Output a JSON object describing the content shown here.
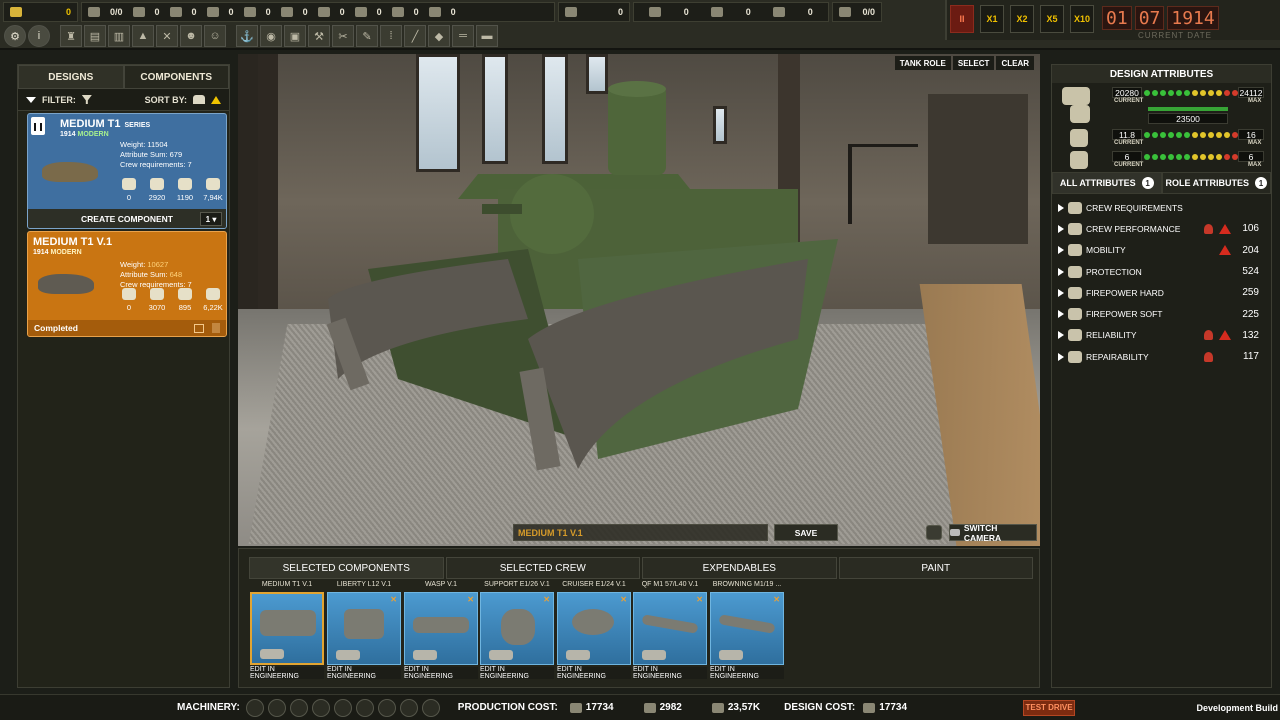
{
  "resources": {
    "money": "0",
    "items": [
      {
        "icon": "rubber-icon",
        "value": "0/0"
      },
      {
        "icon": "steel-icon",
        "value": "0"
      },
      {
        "icon": "fuel-icon",
        "value": "0"
      },
      {
        "icon": "coal-icon",
        "value": "0"
      },
      {
        "icon": "aluminium-icon",
        "value": "0"
      },
      {
        "icon": "wood-icon",
        "value": "0"
      },
      {
        "icon": "oil-icon",
        "value": "0"
      },
      {
        "icon": "chemicals-icon",
        "value": "0"
      },
      {
        "icon": "iron-icon",
        "value": "0"
      },
      {
        "icon": "tools-icon",
        "value": "0"
      }
    ],
    "factory": "0",
    "workers": [
      "0",
      "0",
      "0"
    ],
    "housing": "0/0"
  },
  "speed": {
    "pause": "II",
    "x1": "X1",
    "x2": "X2",
    "x5": "X5",
    "x10": "X10"
  },
  "date": {
    "day": "01",
    "month": "07",
    "year": "1914",
    "label": "CURRENT DATE"
  },
  "left": {
    "tabs": [
      "DESIGNS",
      "COMPONENTS"
    ],
    "filter_label": "FILTER:",
    "sortby_label": "SORT BY:",
    "cards": [
      {
        "title": "MEDIUM T1",
        "tag": "SERIES",
        "year": "1914",
        "era": "MODERN",
        "weight": "Weight: 11504",
        "attr": "Attribute Sum: 679",
        "crew": "Crew requirements: 7",
        "stats": [
          "0",
          "2920",
          "1190",
          "7,94K"
        ],
        "action": "CREATE COMPONENT",
        "qty": "1"
      },
      {
        "title": "MEDIUM T1 V.1",
        "year": "1914",
        "era": "MODERN",
        "weight_label": "Weight:",
        "weight_value": "10627",
        "attr_label": "Attribute Sum:",
        "attr_value": "648",
        "crew": "Crew requirements: 7",
        "stats": [
          "0",
          "3070",
          "895",
          "6,22K"
        ],
        "status": "Completed"
      }
    ]
  },
  "scene": {
    "tank_role": "TANK ROLE",
    "select": "SELECT",
    "clear": "CLEAR",
    "design_name": "MEDIUM T1 V.1",
    "save": "SAVE",
    "switch_camera": "SWITCH CAMERA"
  },
  "right": {
    "title": "DESIGN ATTRIBUTES",
    "rows": [
      {
        "current": "20280",
        "max": "24112"
      },
      {
        "mid": "23500"
      },
      {
        "current": "11.8",
        "max": "16"
      },
      {
        "current": "6",
        "max": "6"
      }
    ],
    "current_label": "CURRENT",
    "max_label": "MAX",
    "tabs": [
      {
        "label": "ALL ATTRIBUTES",
        "badge": "1"
      },
      {
        "label": "ROLE ATTRIBUTES",
        "badge": "1"
      }
    ],
    "attributes": [
      {
        "name": "CREW REQUIREMENTS",
        "value": ""
      },
      {
        "name": "CREW PERFORMANCE",
        "value": "106"
      },
      {
        "name": "MOBILITY",
        "value": "204"
      },
      {
        "name": "PROTECTION",
        "value": "524"
      },
      {
        "name": "FIREPOWER HARD",
        "value": "259"
      },
      {
        "name": "FIREPOWER SOFT",
        "value": "225"
      },
      {
        "name": "RELIABILITY",
        "value": "132"
      },
      {
        "name": "REPAIRABILITY",
        "value": "117"
      }
    ]
  },
  "bottom": {
    "tabs": [
      "SELECTED COMPONENTS",
      "SELECTED CREW",
      "EXPENDABLES",
      "PAINT"
    ],
    "components": [
      {
        "name": "MEDIUM T1 V.1",
        "action": "EDIT IN ENGINEERING"
      },
      {
        "name": "LIBERTY L12 V.1",
        "action": "EDIT IN ENGINEERING"
      },
      {
        "name": "WASP V.1",
        "action": "EDIT IN ENGINEERING"
      },
      {
        "name": "SUPPORT E1/26 V.1",
        "action": "EDIT IN ENGINEERING"
      },
      {
        "name": "CRUISER E1/24 V.1",
        "action": "EDIT IN ENGINEERING"
      },
      {
        "name": "QF M1 57/L40 V.1",
        "action": "EDIT IN ENGINEERING"
      },
      {
        "name": "BROWNING M1/19 ...",
        "action": "EDIT IN ENGINEERING"
      }
    ]
  },
  "footer": {
    "machinery": "MACHINERY:",
    "production_cost": "PRODUCTION COST:",
    "prod_values": [
      "17734",
      "2982",
      "23,57K"
    ],
    "design_cost": "DESIGN COST:",
    "design_value": "17734",
    "test_drive": "TEST DRIVE",
    "build": "Development Build"
  }
}
